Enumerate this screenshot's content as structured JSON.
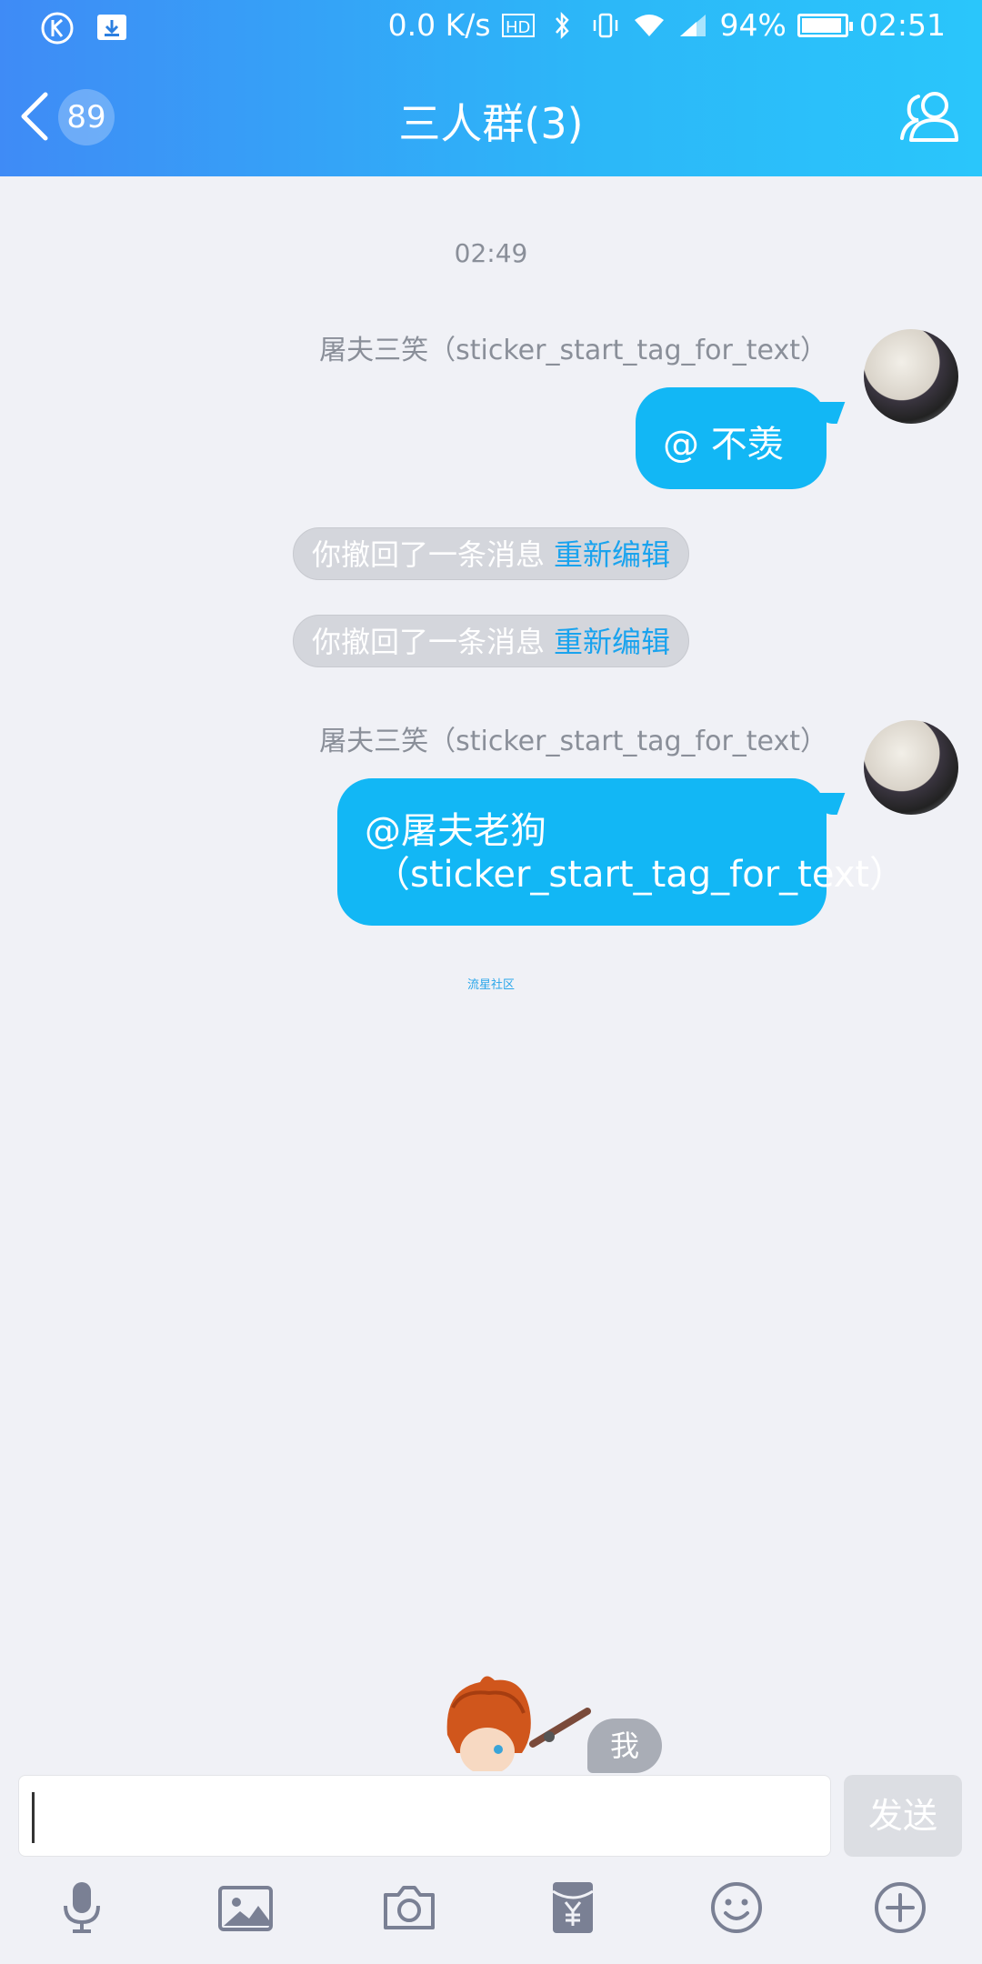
{
  "status_bar": {
    "speed": "0.0 K/s",
    "battery_percent": "94%",
    "battery_level": 0.94,
    "time": "02:51",
    "icons": [
      "k-app-icon",
      "download-icon",
      "hd-icon",
      "bluetooth-icon",
      "vibrate-icon",
      "wifi-icon",
      "signal-icon",
      "battery-icon"
    ]
  },
  "header": {
    "back_badge": "89",
    "title": "三人群(3)",
    "group_icon": "group-members-icon"
  },
  "chat": {
    "timestamp": "02:49",
    "messages": [
      {
        "sender": "屠夫三笑（sticker_start_tag_for_text）",
        "text": "@ 不羡"
      },
      {
        "sender": "屠夫三笑（sticker_start_tag_for_text）",
        "line1": "@屠夫老狗",
        "line2": "（sticker_start_tag_for_text）"
      }
    ],
    "recalls": [
      {
        "text": "你撤回了一条消息",
        "action": "重新编辑"
      },
      {
        "text": "你撤回了一条消息",
        "action": "重新编辑"
      }
    ],
    "footer_label": "流星社区",
    "me_tag": "我"
  },
  "input_bar": {
    "send_label": "发送",
    "tools": [
      "microphone-icon",
      "image-icon",
      "camera-icon",
      "red-packet-icon",
      "emoji-icon",
      "plus-icon"
    ]
  },
  "colors": {
    "header_start": "#3f8bf6",
    "header_end": "#2ac6fb",
    "bubble": "#12b7f5",
    "link": "#1aa3ee",
    "background": "#f0f1f6"
  }
}
